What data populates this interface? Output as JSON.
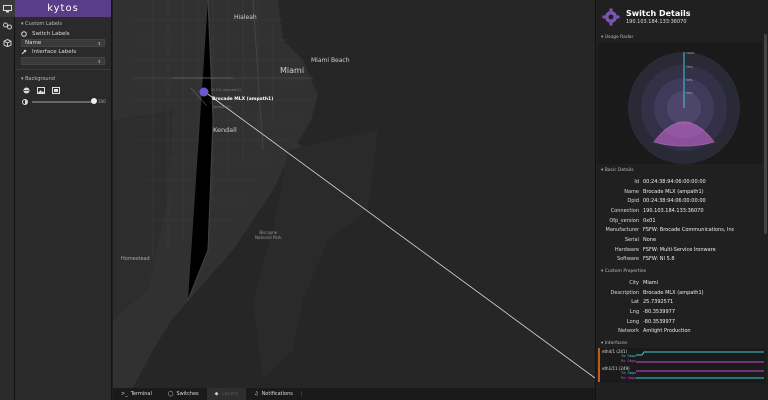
{
  "app": {
    "logo": "kytos"
  },
  "left_panel": {
    "custom_labels_header": "Custom Labels",
    "switch_labels_label": "Switch Labels",
    "switch_label_select": "Name",
    "interface_labels_label": "Interface Labels",
    "interface_label_select": "",
    "background_header": "Background",
    "opacity_value": "100"
  },
  "map": {
    "labels": {
      "hialeah": "Hialeah",
      "miami": "Miami",
      "miami_beach": "Miami Beach",
      "kendall": "Kendall",
      "homestead": "Homestead",
      "biscayne": "Biscayne\nNational Park",
      "switch_tooltip": "Brocade MLX (ampath1)",
      "faint_a": "NI 5.8 (ampath1)",
      "faint_b": "(ampath1)"
    }
  },
  "bottom_bar": {
    "tabs": [
      "Terminal",
      "Switches",
      "Layers",
      "Notifications"
    ]
  },
  "switch_details": {
    "title": "Switch Details",
    "subtitle": "190.103.184.133:36070",
    "usage_radar_header": "Usage Radar",
    "radar_ticks": [
      "100%",
      "75%",
      "50%",
      "25%"
    ],
    "basic_details_header": "Basic Details",
    "basic_details": [
      {
        "key": "Id",
        "value": "00:24:38:94:06:00:00:00"
      },
      {
        "key": "Name",
        "value": "Brocade MLX (ampath1)"
      },
      {
        "key": "Dpid",
        "value": "00:24:38:94:06:00:00:00"
      },
      {
        "key": "Connection",
        "value": "190.103.184.133:36070"
      },
      {
        "key": "Ofp_version",
        "value": "0x01"
      },
      {
        "key": "Manufacturer",
        "value": "FSFW: Brocade Communications, Inc"
      },
      {
        "key": "Serial",
        "value": "None"
      },
      {
        "key": "Hardware",
        "value": "FSFW: Multi-Service Ironware"
      },
      {
        "key": "Software",
        "value": "FSFW: NI 5.8"
      }
    ],
    "custom_properties_header": "Custom Properties",
    "custom_properties": [
      {
        "key": "City",
        "value": "Miami"
      },
      {
        "key": "Description",
        "value": "Brocade MLX (ampath1)"
      },
      {
        "key": "Lat",
        "value": "25.7392571"
      },
      {
        "key": "Lng",
        "value": "-80.3539977"
      },
      {
        "key": "Long",
        "value": "-80.3539977"
      },
      {
        "key": "Network",
        "value": "Amlight Production"
      }
    ],
    "interfaces_header": "Interfaces",
    "interfaces": [
      {
        "name": "eth4/1 (241)",
        "tx": "Tx: 0bps",
        "rx": "Rx: 0bps"
      },
      {
        "name": "eth1/11 (249)",
        "tx": "Tx: 0bps",
        "rx": "Rx: 0bps"
      }
    ],
    "colors": {
      "accent": "#5a3d8a",
      "radar": "#d56de0",
      "iface_line_a": "#3ec9d6",
      "iface_line_b": "#c64bd6"
    }
  }
}
